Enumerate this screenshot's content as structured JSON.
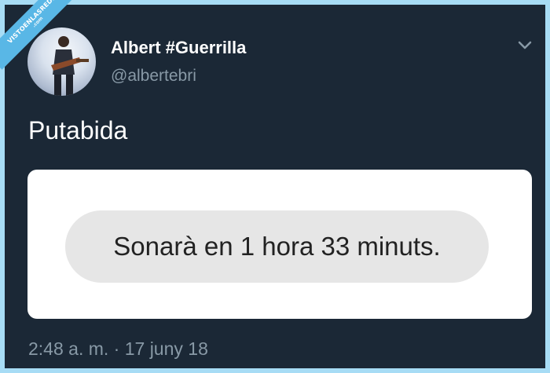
{
  "watermark": {
    "main": "VISTOENLASREDES",
    "sub": ".com"
  },
  "tweet": {
    "author": {
      "display_name": "Albert #Guerrilla",
      "handle": "@albertebri",
      "avatar_icon": "guitarist-avatar"
    },
    "menu_icon": "chevron-down-icon",
    "text": "Putabida",
    "media": {
      "toast_text": "Sonarà en 1 hora 33 minuts."
    },
    "timestamp": "2:48 a. m. · 17 juny 18"
  },
  "colors": {
    "background": "#1b2836",
    "frame": "#a7dcf5",
    "watermark": "#59b7e6",
    "secondary_text": "#8899a6",
    "toast_background": "#e6e6e6"
  }
}
